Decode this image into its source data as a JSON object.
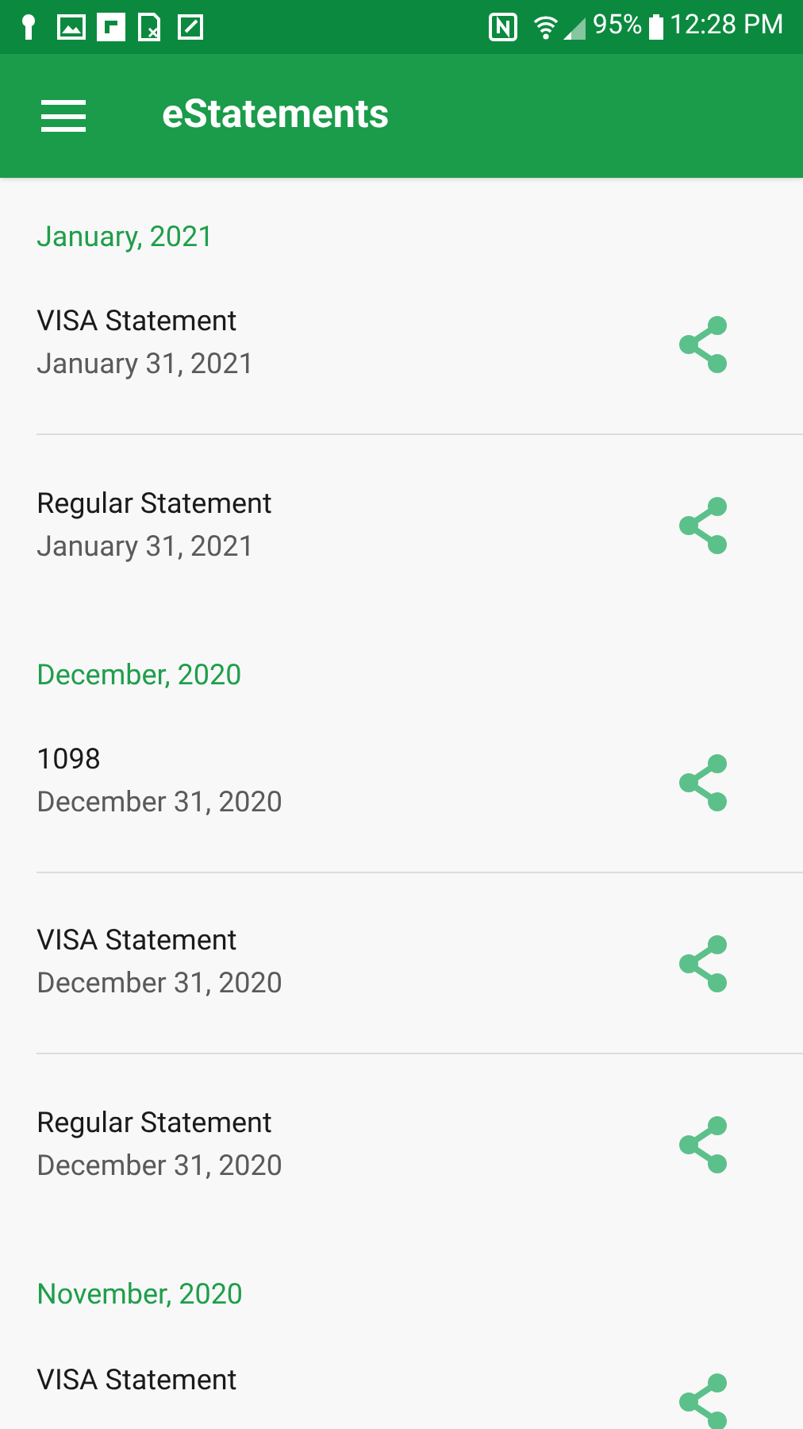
{
  "status_bar": {
    "battery": "95%",
    "time": "12:28 PM"
  },
  "app_bar": {
    "title": "eStatements"
  },
  "sections": [
    {
      "heading": "January, 2021",
      "items": [
        {
          "title": "VISA Statement",
          "date": "January 31, 2021"
        },
        {
          "title": "Regular Statement",
          "date": "January 31, 2021"
        }
      ]
    },
    {
      "heading": "December, 2020",
      "items": [
        {
          "title": "1098",
          "date": "December 31, 2020"
        },
        {
          "title": "VISA Statement",
          "date": "December 31, 2020"
        },
        {
          "title": "Regular Statement",
          "date": "December 31, 2020"
        }
      ]
    },
    {
      "heading": "November, 2020",
      "items": [
        {
          "title": "VISA Statement"
        }
      ]
    }
  ]
}
